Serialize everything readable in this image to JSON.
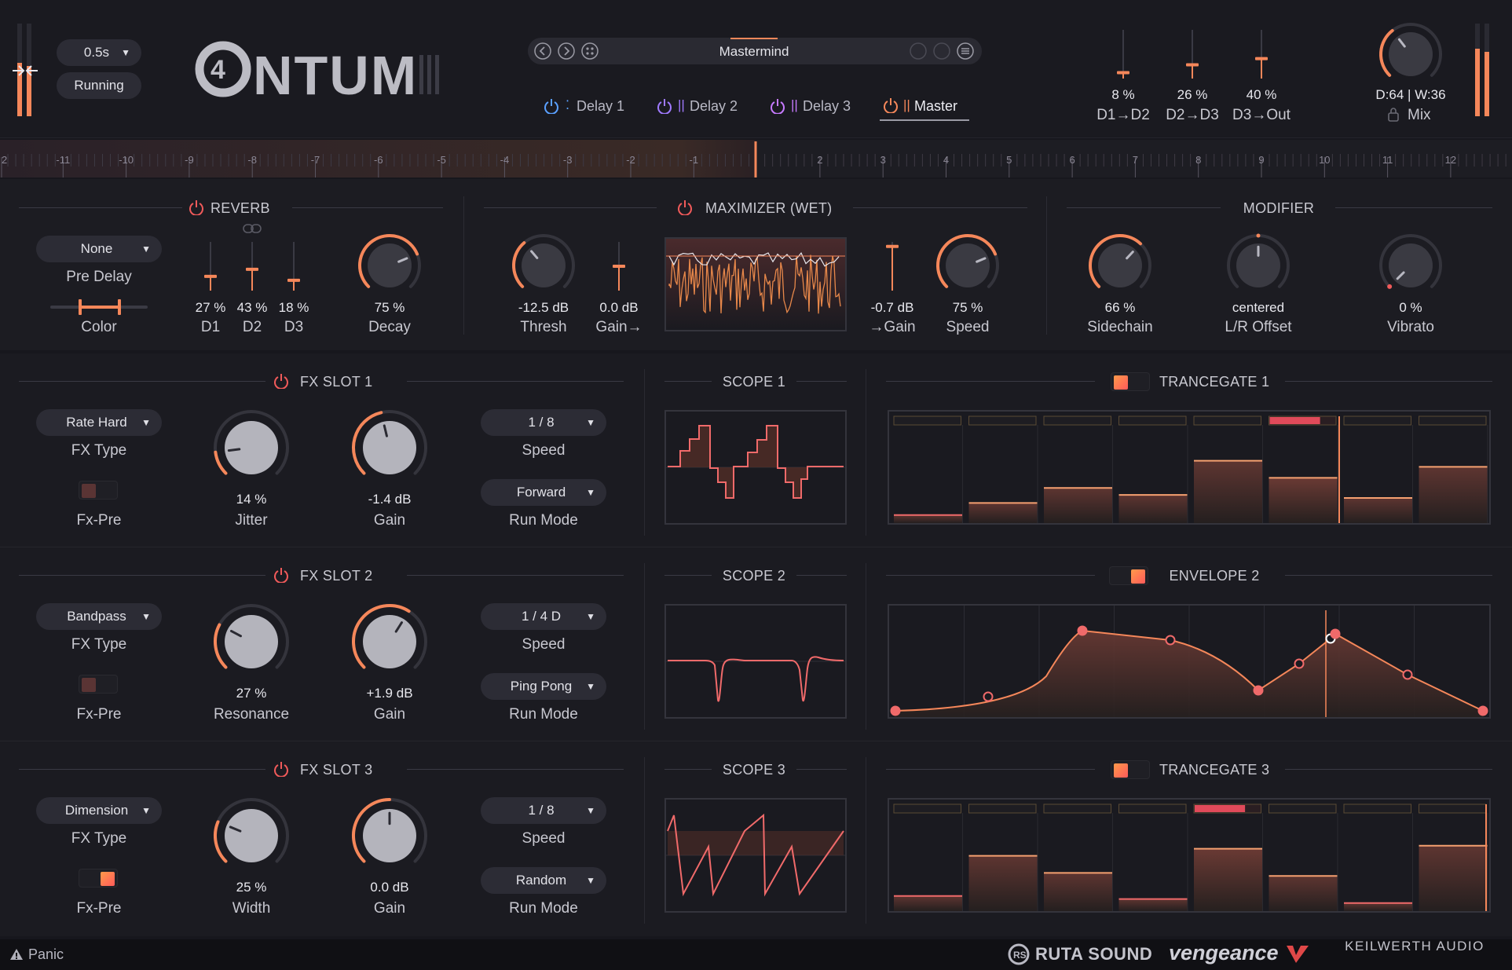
{
  "colors": {
    "accent": "#f5875a",
    "accent_pink": "#f0506a",
    "bg": "#17171d",
    "panel": "#1c1c22",
    "blue": "#5aa0ff",
    "purple": "#a07aff",
    "violet": "#c67aff"
  },
  "header": {
    "time_select": "0.5s",
    "status": "Running",
    "logo": "4NTUM",
    "preset_name": "Mastermind",
    "tabs": [
      {
        "label": "Delay 1",
        "color": "#5aa0ff"
      },
      {
        "label": "Delay 2",
        "color": "#a07aff"
      },
      {
        "label": "Delay 3",
        "color": "#c67aff"
      },
      {
        "label": "Master",
        "color": "#f5875a"
      }
    ],
    "routing": [
      {
        "value": "8 %",
        "label": "D1→D2",
        "level": 0.08
      },
      {
        "value": "26 %",
        "label": "D2→D3",
        "level": 0.26
      },
      {
        "value": "40 %",
        "label": "D3→Out",
        "level": 0.4
      }
    ],
    "mix": {
      "readout": "D:64 | W:36",
      "label": "Mix",
      "level": 0.36
    }
  },
  "timeline": {
    "ticks": [
      "2",
      "-11",
      "-10",
      "-9",
      "-8",
      "-7",
      "-6",
      "-5",
      "-4",
      "-3",
      "-2",
      "-1",
      "",
      "2",
      "3",
      "4",
      "5",
      "6",
      "7",
      "8",
      "9",
      "10",
      "11",
      "12"
    ]
  },
  "reverb": {
    "title": "REVERB",
    "pre_delay": "None",
    "pre_delay_label": "Pre Delay",
    "color_label": "Color",
    "faders": [
      {
        "value": "27 %",
        "label": "D1",
        "level": 0.27
      },
      {
        "value": "43 %",
        "label": "D2",
        "level": 0.43
      },
      {
        "value": "18 %",
        "label": "D3",
        "level": 0.18
      }
    ],
    "decay": {
      "value": "75 %",
      "label": "Decay",
      "level": 0.75
    }
  },
  "maximizer": {
    "title": "MAXIMIZER (WET)",
    "thresh": {
      "value": "-12.5 dB",
      "label": "Thresh",
      "level": 0.35
    },
    "gain_in": {
      "value": "0.0 dB",
      "label": "Gain→",
      "level": 0.5
    },
    "gain_out": {
      "value": "-0.7 dB",
      "label": "→Gain",
      "level": 0.95
    },
    "speed": {
      "value": "75 %",
      "label": "Speed",
      "level": 0.75
    }
  },
  "modifier": {
    "title": "MODIFIER",
    "sidechain": {
      "value": "66 %",
      "label": "Sidechain",
      "level": 0.66
    },
    "lr_offset": {
      "value": "centered",
      "label": "L/R Offset",
      "level": 0.5
    },
    "vibrato": {
      "value": "0 %",
      "label": "Vibrato",
      "level": 0.0
    }
  },
  "slots": [
    {
      "title": "FX SLOT 1",
      "fx_type": "Rate Hard",
      "fx_type_label": "FX Type",
      "fx_pre_label": "Fx-Pre",
      "fx_pre_on": false,
      "k1": {
        "value": "14 %",
        "label": "Jitter",
        "level": 0.14
      },
      "k2": {
        "value": "-1.4 dB",
        "label": "Gain",
        "level": 0.45
      },
      "speed": "1 / 8",
      "speed_label": "Speed",
      "run_mode": "Forward",
      "run_mode_label": "Run Mode",
      "scope_title": "SCOPE 1",
      "mod_title": "TRANCEGATE 1",
      "mod_toggle_left": true
    },
    {
      "title": "FX SLOT 2",
      "fx_type": "Bandpass",
      "fx_type_label": "FX Type",
      "fx_pre_label": "Fx-Pre",
      "fx_pre_on": false,
      "k1": {
        "value": "27 %",
        "label": "Resonance",
        "level": 0.27
      },
      "k2": {
        "value": "+1.9 dB",
        "label": "Gain",
        "level": 0.62
      },
      "speed": "1 / 4 D",
      "speed_label": "Speed",
      "run_mode": "Ping Pong",
      "run_mode_label": "Run Mode",
      "scope_title": "SCOPE 2",
      "mod_title": "ENVELOPE 2",
      "mod_toggle_left": false
    },
    {
      "title": "FX SLOT 3",
      "fx_type": "Dimension",
      "fx_type_label": "FX Type",
      "fx_pre_label": "Fx-Pre",
      "fx_pre_on": true,
      "k1": {
        "value": "25 %",
        "label": "Width",
        "level": 0.25
      },
      "k2": {
        "value": "0.0 dB",
        "label": "Gain",
        "level": 0.5
      },
      "speed": "1 / 8",
      "speed_label": "Speed",
      "run_mode": "Random",
      "run_mode_label": "Run Mode",
      "scope_title": "SCOPE 3",
      "mod_title": "TRANCEGATE 3",
      "mod_toggle_left": true
    }
  ],
  "trancegate1": [
    0.08,
    0.2,
    0.35,
    0.28,
    0.62,
    0.45,
    0.25,
    0.56
  ],
  "trancegate3": [
    0.15,
    0.55,
    0.38,
    0.12,
    0.62,
    0.35,
    0.08,
    0.65
  ],
  "footer": {
    "panic": "Panic",
    "brand1": "RUTA SOUND",
    "brand2": "vengeance",
    "brand3": "KEILWERTH AUDIO"
  }
}
